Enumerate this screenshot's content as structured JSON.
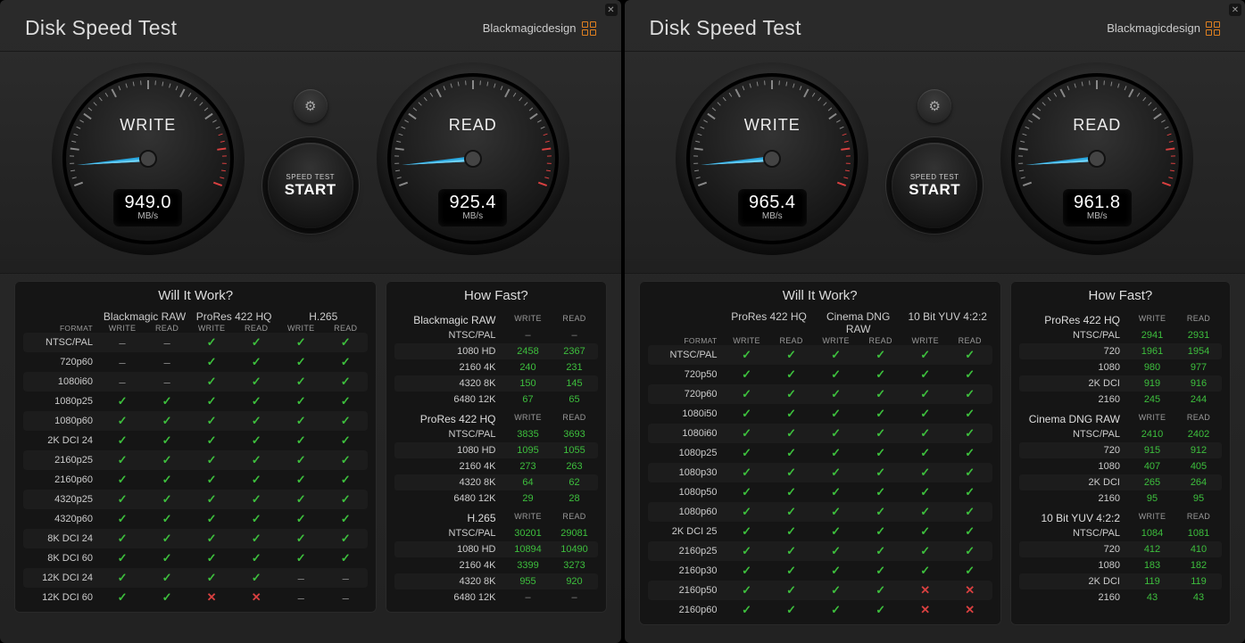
{
  "apps": [
    {
      "title": "Disk Speed Test",
      "brand": "Blackmagicdesign",
      "gauges": {
        "write": {
          "label": "WRITE",
          "value": "949.0",
          "unit": "MB/s"
        },
        "read": {
          "label": "READ",
          "value": "925.4",
          "unit": "MB/s"
        }
      },
      "start": {
        "small": "SPEED TEST",
        "big": "START"
      },
      "wit": {
        "title": "Will It Work?",
        "format_label": "FORMAT",
        "wr": "WRITE",
        "rd": "READ",
        "codecs": [
          "Blackmagic RAW",
          "ProRes 422 HQ",
          "H.265"
        ],
        "rows": [
          {
            "fmt": "NTSC/PAL",
            "v": [
              "dash",
              "dash",
              "check",
              "check",
              "check",
              "check"
            ]
          },
          {
            "fmt": "720p60",
            "v": [
              "dash",
              "dash",
              "check",
              "check",
              "check",
              "check"
            ]
          },
          {
            "fmt": "1080i60",
            "v": [
              "dash",
              "dash",
              "check",
              "check",
              "check",
              "check"
            ]
          },
          {
            "fmt": "1080p25",
            "v": [
              "check",
              "check",
              "check",
              "check",
              "check",
              "check"
            ]
          },
          {
            "fmt": "1080p60",
            "v": [
              "check",
              "check",
              "check",
              "check",
              "check",
              "check"
            ]
          },
          {
            "fmt": "2K DCI 24",
            "v": [
              "check",
              "check",
              "check",
              "check",
              "check",
              "check"
            ]
          },
          {
            "fmt": "2160p25",
            "v": [
              "check",
              "check",
              "check",
              "check",
              "check",
              "check"
            ]
          },
          {
            "fmt": "2160p60",
            "v": [
              "check",
              "check",
              "check",
              "check",
              "check",
              "check"
            ]
          },
          {
            "fmt": "4320p25",
            "v": [
              "check",
              "check",
              "check",
              "check",
              "check",
              "check"
            ]
          },
          {
            "fmt": "4320p60",
            "v": [
              "check",
              "check",
              "check",
              "check",
              "check",
              "check"
            ]
          },
          {
            "fmt": "8K DCI 24",
            "v": [
              "check",
              "check",
              "check",
              "check",
              "check",
              "check"
            ]
          },
          {
            "fmt": "8K DCI 60",
            "v": [
              "check",
              "check",
              "check",
              "check",
              "check",
              "check"
            ]
          },
          {
            "fmt": "12K DCI 24",
            "v": [
              "check",
              "check",
              "check",
              "check",
              "dash",
              "dash"
            ]
          },
          {
            "fmt": "12K DCI 60",
            "v": [
              "check",
              "check",
              "cross",
              "cross",
              "dash",
              "dash"
            ]
          }
        ]
      },
      "hf": {
        "title": "How Fast?",
        "wr": "WRITE",
        "rd": "READ",
        "groups": [
          {
            "name": "Blackmagic RAW",
            "rows": [
              {
                "res": "NTSC/PAL",
                "w": "–",
                "r": "–"
              },
              {
                "res": "1080 HD",
                "w": "2458",
                "r": "2367"
              },
              {
                "res": "2160 4K",
                "w": "240",
                "r": "231"
              },
              {
                "res": "4320 8K",
                "w": "150",
                "r": "145"
              },
              {
                "res": "6480 12K",
                "w": "67",
                "r": "65"
              }
            ]
          },
          {
            "name": "ProRes 422 HQ",
            "rows": [
              {
                "res": "NTSC/PAL",
                "w": "3835",
                "r": "3693"
              },
              {
                "res": "1080 HD",
                "w": "1095",
                "r": "1055"
              },
              {
                "res": "2160 4K",
                "w": "273",
                "r": "263"
              },
              {
                "res": "4320 8K",
                "w": "64",
                "r": "62"
              },
              {
                "res": "6480 12K",
                "w": "29",
                "r": "28"
              }
            ]
          },
          {
            "name": "H.265",
            "rows": [
              {
                "res": "NTSC/PAL",
                "w": "30201",
                "r": "29081"
              },
              {
                "res": "1080 HD",
                "w": "10894",
                "r": "10490"
              },
              {
                "res": "2160 4K",
                "w": "3399",
                "r": "3273"
              },
              {
                "res": "4320 8K",
                "w": "955",
                "r": "920"
              },
              {
                "res": "6480 12K",
                "w": "–",
                "r": "–"
              }
            ]
          }
        ]
      }
    },
    {
      "title": "Disk Speed Test",
      "brand": "Blackmagicdesign",
      "gauges": {
        "write": {
          "label": "WRITE",
          "value": "965.4",
          "unit": "MB/s"
        },
        "read": {
          "label": "READ",
          "value": "961.8",
          "unit": "MB/s"
        }
      },
      "start": {
        "small": "SPEED TEST",
        "big": "START"
      },
      "wit": {
        "title": "Will It Work?",
        "format_label": "FORMAT",
        "wr": "WRITE",
        "rd": "READ",
        "codecs": [
          "ProRes 422 HQ",
          "Cinema DNG RAW",
          "10 Bit YUV 4:2:2"
        ],
        "rows": [
          {
            "fmt": "NTSC/PAL",
            "v": [
              "check",
              "check",
              "check",
              "check",
              "check",
              "check"
            ]
          },
          {
            "fmt": "720p50",
            "v": [
              "check",
              "check",
              "check",
              "check",
              "check",
              "check"
            ]
          },
          {
            "fmt": "720p60",
            "v": [
              "check",
              "check",
              "check",
              "check",
              "check",
              "check"
            ]
          },
          {
            "fmt": "1080i50",
            "v": [
              "check",
              "check",
              "check",
              "check",
              "check",
              "check"
            ]
          },
          {
            "fmt": "1080i60",
            "v": [
              "check",
              "check",
              "check",
              "check",
              "check",
              "check"
            ]
          },
          {
            "fmt": "1080p25",
            "v": [
              "check",
              "check",
              "check",
              "check",
              "check",
              "check"
            ]
          },
          {
            "fmt": "1080p30",
            "v": [
              "check",
              "check",
              "check",
              "check",
              "check",
              "check"
            ]
          },
          {
            "fmt": "1080p50",
            "v": [
              "check",
              "check",
              "check",
              "check",
              "check",
              "check"
            ]
          },
          {
            "fmt": "1080p60",
            "v": [
              "check",
              "check",
              "check",
              "check",
              "check",
              "check"
            ]
          },
          {
            "fmt": "2K DCI 25",
            "v": [
              "check",
              "check",
              "check",
              "check",
              "check",
              "check"
            ]
          },
          {
            "fmt": "2160p25",
            "v": [
              "check",
              "check",
              "check",
              "check",
              "check",
              "check"
            ]
          },
          {
            "fmt": "2160p30",
            "v": [
              "check",
              "check",
              "check",
              "check",
              "check",
              "check"
            ]
          },
          {
            "fmt": "2160p50",
            "v": [
              "check",
              "check",
              "check",
              "check",
              "cross",
              "cross"
            ]
          },
          {
            "fmt": "2160p60",
            "v": [
              "check",
              "check",
              "check",
              "check",
              "cross",
              "cross"
            ]
          }
        ]
      },
      "hf": {
        "title": "How Fast?",
        "wr": "WRITE",
        "rd": "READ",
        "groups": [
          {
            "name": "ProRes 422 HQ",
            "rows": [
              {
                "res": "NTSC/PAL",
                "w": "2941",
                "r": "2931"
              },
              {
                "res": "720",
                "w": "1961",
                "r": "1954"
              },
              {
                "res": "1080",
                "w": "980",
                "r": "977"
              },
              {
                "res": "2K DCI",
                "w": "919",
                "r": "916"
              },
              {
                "res": "2160",
                "w": "245",
                "r": "244"
              }
            ]
          },
          {
            "name": "Cinema DNG RAW",
            "rows": [
              {
                "res": "NTSC/PAL",
                "w": "2410",
                "r": "2402"
              },
              {
                "res": "720",
                "w": "915",
                "r": "912"
              },
              {
                "res": "1080",
                "w": "407",
                "r": "405"
              },
              {
                "res": "2K DCI",
                "w": "265",
                "r": "264"
              },
              {
                "res": "2160",
                "w": "95",
                "r": "95"
              }
            ]
          },
          {
            "name": "10 Bit YUV 4:2:2",
            "rows": [
              {
                "res": "NTSC/PAL",
                "w": "1084",
                "r": "1081"
              },
              {
                "res": "720",
                "w": "412",
                "r": "410"
              },
              {
                "res": "1080",
                "w": "183",
                "r": "182"
              },
              {
                "res": "2K DCI",
                "w": "119",
                "r": "119"
              },
              {
                "res": "2160",
                "w": "43",
                "r": "43"
              }
            ]
          }
        ]
      }
    }
  ]
}
